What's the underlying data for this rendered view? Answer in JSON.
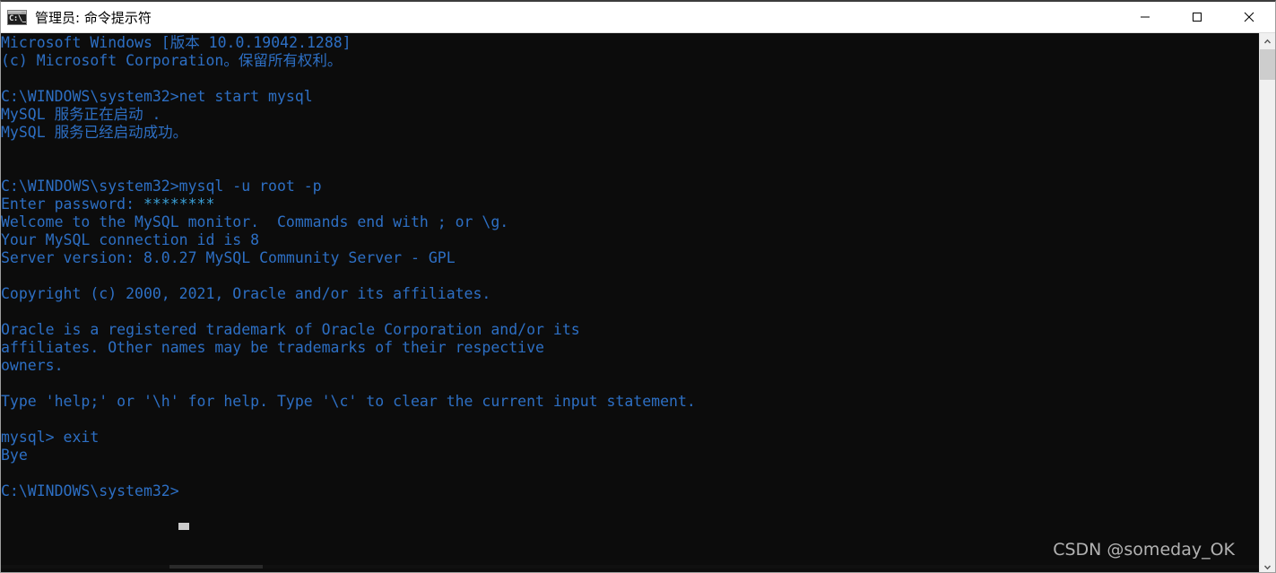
{
  "window": {
    "title": "管理员: 命令提示符",
    "icon": "cmd-console-icon",
    "icon_glyph": "C:\\_",
    "controls": {
      "minimize": "—",
      "maximize": "□",
      "close": "✕"
    }
  },
  "console": {
    "background_color": "#0c0c0c",
    "text_color": "#2d6fc4",
    "password_color": "#3aa0d8",
    "prompt": "C:\\WINDOWS\\system32>",
    "cursor": "block-cursor",
    "lines": [
      {
        "text": "Microsoft Windows [版本 10.0.19042.1288]"
      },
      {
        "text": "(c) Microsoft Corporation。保留所有权利。"
      },
      {
        "text": ""
      },
      {
        "text": "C:\\WINDOWS\\system32>net start mysql"
      },
      {
        "text": "MySQL 服务正在启动 ."
      },
      {
        "text": "MySQL 服务已经启动成功。"
      },
      {
        "text": ""
      },
      {
        "text": ""
      },
      {
        "text": "C:\\WINDOWS\\system32>mysql -u root -p"
      },
      {
        "text": "Enter password: ",
        "suffix": "********",
        "suffix_class": "pw"
      },
      {
        "text": "Welcome to the MySQL monitor.  Commands end with ; or \\g."
      },
      {
        "text": "Your MySQL connection id is 8"
      },
      {
        "text": "Server version: 8.0.27 MySQL Community Server - GPL"
      },
      {
        "text": ""
      },
      {
        "text": "Copyright (c) 2000, 2021, Oracle and/or its affiliates."
      },
      {
        "text": ""
      },
      {
        "text": "Oracle is a registered trademark of Oracle Corporation and/or its"
      },
      {
        "text": "affiliates. Other names may be trademarks of their respective"
      },
      {
        "text": "owners."
      },
      {
        "text": ""
      },
      {
        "text": "Type 'help;' or '\\h' for help. Type '\\c' to clear the current input statement."
      },
      {
        "text": ""
      },
      {
        "text": "mysql> exit"
      },
      {
        "text": "Bye"
      },
      {
        "text": ""
      },
      {
        "text": "C:\\WINDOWS\\system32>"
      }
    ]
  },
  "watermark": {
    "text": "CSDN @someday_OK"
  },
  "scrollbar": {
    "vertical": {
      "up_arrow": "chevron-up",
      "down_arrow": "chevron-down",
      "thumb_color": "#cdcdcd",
      "track_color": "#f0f0f0"
    },
    "horizontal": {
      "thumb_color": "#2a2a2a"
    }
  }
}
